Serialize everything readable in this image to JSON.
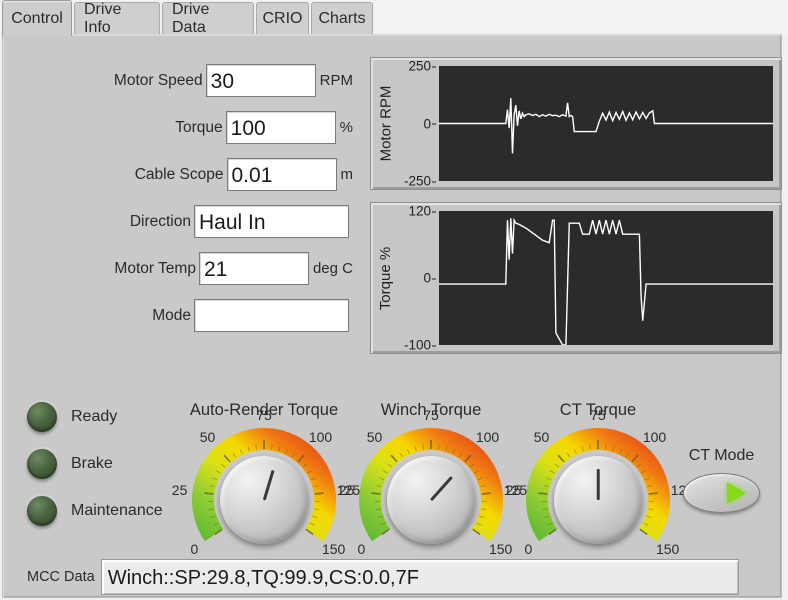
{
  "tabs": [
    {
      "label": "Control",
      "active": true
    },
    {
      "label": "Drive Info",
      "active": false
    },
    {
      "label": "Drive Data",
      "active": false
    },
    {
      "label": "CRIO",
      "active": false
    },
    {
      "label": "Charts",
      "active": false
    }
  ],
  "form": {
    "motor_speed": {
      "label": "Motor Speed",
      "value": "30",
      "unit": "RPM"
    },
    "torque": {
      "label": "Torque",
      "value": "100",
      "unit": "%"
    },
    "cable_scope": {
      "label": "Cable Scope",
      "value": "0.01",
      "unit": "m"
    },
    "direction": {
      "label": "Direction",
      "value": "Haul In",
      "unit": ""
    },
    "motor_temp": {
      "label": "Motor Temp",
      "value": "21",
      "unit": "deg C"
    },
    "mode": {
      "label": "Mode",
      "value": "",
      "unit": ""
    }
  },
  "leds": [
    {
      "label": "Ready",
      "state": "off",
      "color": "#4a6340"
    },
    {
      "label": "Brake",
      "state": "off",
      "color": "#4a6340"
    },
    {
      "label": "Maintenance",
      "state": "off",
      "color": "#4a6340"
    }
  ],
  "gauges": [
    {
      "title": "Auto-Render Torque",
      "value": 85,
      "min": 0,
      "max": 150,
      "ticks": [
        "0",
        "25",
        "50",
        "75",
        "100",
        "125",
        "150"
      ]
    },
    {
      "title": "Winch Torque",
      "value": 100,
      "min": 0,
      "max": 150,
      "ticks": [
        "0",
        "25",
        "50",
        "75",
        "100",
        "125",
        "150"
      ]
    },
    {
      "title": "CT Torque",
      "value": 75,
      "min": 0,
      "max": 150,
      "ticks": [
        "0",
        "25",
        "50",
        "75",
        "100",
        "125",
        "150"
      ]
    }
  ],
  "ct_mode": {
    "label": "CT Mode",
    "icon": "play-triangle-icon",
    "color": "#86d919",
    "state": "on"
  },
  "mcc": {
    "label": "MCC Data",
    "value": "Winch::SP:29.8,TQ:99.9,CS:0.0,7F"
  },
  "colors": {
    "panel": "#c9c9c9",
    "plot_background": "#2b2b2b",
    "trace": "#ffffff",
    "gauge_low": "#7ac943",
    "gauge_mid": "#f2e600",
    "gauge_high": "#e02020"
  },
  "chart_data": [
    {
      "type": "line",
      "title": "",
      "ylabel": "Motor RPM",
      "xlabel": "",
      "ylim": [
        -250,
        250
      ],
      "yticks": [
        250,
        0,
        -250
      ],
      "ytick_labels": [
        "250",
        "0",
        "-250"
      ],
      "grid": false,
      "legend": "none",
      "series": [
        {
          "name": "Motor RPM",
          "color": "#ffffff",
          "x": [
            0,
            0.05,
            0.1,
            0.15,
            0.18,
            0.2,
            0.205,
            0.21,
            0.215,
            0.22,
            0.225,
            0.23,
            0.235,
            0.24,
            0.245,
            0.25,
            0.255,
            0.26,
            0.27,
            0.28,
            0.29,
            0.3,
            0.31,
            0.32,
            0.33,
            0.34,
            0.35,
            0.36,
            0.37,
            0.38,
            0.385,
            0.39,
            0.395,
            0.4,
            0.405,
            0.41,
            0.42,
            0.43,
            0.44,
            0.45,
            0.46,
            0.47,
            0.48,
            0.49,
            0.5,
            0.51,
            0.52,
            0.53,
            0.54,
            0.55,
            0.56,
            0.57,
            0.58,
            0.59,
            0.6,
            0.61,
            0.62,
            0.63,
            0.64,
            0.645,
            0.65,
            0.7,
            0.8,
            0.9,
            1.0
          ],
          "y": [
            0,
            0,
            0,
            0,
            0,
            0,
            60,
            -20,
            110,
            -130,
            40,
            80,
            -10,
            55,
            20,
            45,
            30,
            38,
            42,
            35,
            40,
            30,
            38,
            32,
            40,
            34,
            36,
            30,
            38,
            32,
            90,
            30,
            35,
            30,
            -35,
            -35,
            -35,
            -35,
            -35,
            -35,
            -35,
            -35,
            10,
            45,
            15,
            50,
            12,
            48,
            18,
            52,
            14,
            46,
            16,
            50,
            20,
            48,
            22,
            46,
            55,
            0,
            0,
            0,
            0,
            0,
            0
          ]
        }
      ],
      "notes": "white trace active in left ~62% of plot then flat at zero"
    },
    {
      "type": "line",
      "title": "",
      "ylabel": "Torque %",
      "xlabel": "",
      "ylim": [
        -100,
        120
      ],
      "yticks": [
        120,
        0,
        -100
      ],
      "ytick_labels": [
        "120",
        "0",
        "-100"
      ],
      "grid": false,
      "legend": "none",
      "series": [
        {
          "name": "Torque %",
          "color": "#ffffff",
          "x": [
            0,
            0.05,
            0.1,
            0.15,
            0.18,
            0.2,
            0.205,
            0.21,
            0.215,
            0.22,
            0.225,
            0.23,
            0.24,
            0.25,
            0.26,
            0.27,
            0.28,
            0.29,
            0.3,
            0.31,
            0.32,
            0.33,
            0.34,
            0.345,
            0.35,
            0.355,
            0.36,
            0.365,
            0.37,
            0.38,
            0.39,
            0.4,
            0.405,
            0.41,
            0.415,
            0.42,
            0.43,
            0.44,
            0.45,
            0.46,
            0.47,
            0.48,
            0.49,
            0.5,
            0.51,
            0.52,
            0.53,
            0.54,
            0.55,
            0.56,
            0.57,
            0.58,
            0.59,
            0.6,
            0.605,
            0.61,
            0.62,
            0.7,
            0.8,
            0.9,
            1.0
          ],
          "y": [
            0,
            0,
            0,
            0,
            0,
            0,
            105,
            40,
            108,
            50,
            105,
            100,
            98,
            95,
            92,
            88,
            84,
            80,
            76,
            72,
            70,
            68,
            105,
            105,
            -80,
            -85,
            -90,
            -95,
            -100,
            -100,
            100,
            100,
            100,
            100,
            100,
            100,
            82,
            82,
            82,
            105,
            82,
            105,
            82,
            105,
            82,
            105,
            82,
            105,
            82,
            82,
            82,
            82,
            82,
            82,
            -20,
            -60,
            0,
            0,
            0,
            0,
            0
          ]
        }
      ],
      "notes": "white trace active in left ~62% of plot then flat at zero"
    }
  ]
}
